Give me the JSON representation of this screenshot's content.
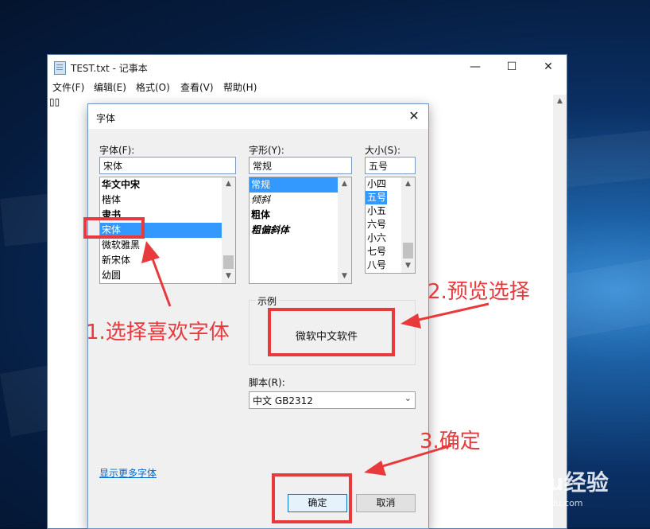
{
  "notepad": {
    "title": "TEST.txt - 记事本",
    "buttons": {
      "minimize": "—",
      "maximize": "☐",
      "close": "✕"
    },
    "menu": [
      "文件(F)",
      "编辑(E)",
      "格式(O)",
      "查看(V)",
      "帮助(H)"
    ],
    "content": "▯▯"
  },
  "dialog": {
    "title": "字体",
    "font": {
      "label": "字体(F):",
      "value": "宋体",
      "items": [
        "华文中宋",
        "楷体",
        "隶书",
        "宋体",
        "微软雅黑",
        "新宋体",
        "幼圆"
      ],
      "selected": "宋体"
    },
    "style": {
      "label": "字形(Y):",
      "value": "常规",
      "items": [
        "常规",
        "倾斜",
        "粗体",
        "粗偏斜体"
      ],
      "selected": "常规"
    },
    "size": {
      "label": "大小(S):",
      "value": "五号",
      "items": [
        "小四",
        "五号",
        "小五",
        "六号",
        "小六",
        "七号",
        "八号"
      ],
      "selected": "五号"
    },
    "sample": {
      "label": "示例",
      "text": "微软中文软件"
    },
    "script": {
      "label": "脚本(R):",
      "value": "中文 GB2312"
    },
    "more_fonts_link": "显示更多字体",
    "ok": "确定",
    "cancel": "取消"
  },
  "annotations": {
    "step1": "1.选择喜欢字体",
    "step2": "2.预览选择",
    "step3": "3.确定",
    "color": "#e8393c"
  },
  "watermark": {
    "brand": "Baidu经验",
    "url": "jingyan.baidu.com"
  }
}
